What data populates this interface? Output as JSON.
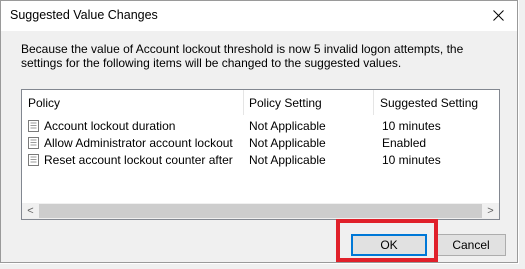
{
  "window": {
    "title": "Suggested Value Changes"
  },
  "message": "Because the value of Account lockout threshold is now 5 invalid logon attempts, the settings for the following items will be changed to the suggested values.",
  "table": {
    "columns": [
      "Policy",
      "Policy Setting",
      "Suggested Setting"
    ],
    "rows": [
      {
        "icon": "policy-icon",
        "policy": "Account lockout duration",
        "setting": "Not Applicable",
        "suggested": "10 minutes"
      },
      {
        "icon": "policy-icon",
        "policy": "Allow Administrator account lockout",
        "setting": "Not Applicable",
        "suggested": "Enabled"
      },
      {
        "icon": "policy-icon",
        "policy": "Reset account lockout counter after",
        "setting": "Not Applicable",
        "suggested": "10 minutes"
      }
    ]
  },
  "scrollbar": {
    "left_arrow": "<",
    "right_arrow": ">"
  },
  "buttons": {
    "ok": "OK",
    "cancel": "Cancel"
  },
  "colors": {
    "highlight": "#e0202a",
    "default_button_border": "#0078d7"
  }
}
